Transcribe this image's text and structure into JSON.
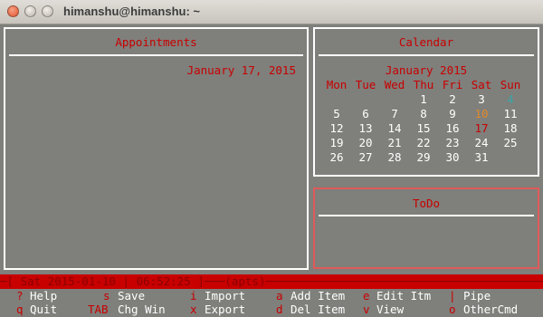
{
  "window": {
    "title": "himanshu@himanshu: ~"
  },
  "appointments": {
    "title": "Appointments",
    "date": "January 17, 2015"
  },
  "calendar": {
    "title": "Calendar",
    "month": "January 2015",
    "weekdays": [
      "Mon",
      "Tue",
      "Wed",
      "Thu",
      "Fri",
      "Sat",
      "Sun"
    ],
    "weeks": [
      [
        "",
        "",
        "",
        "1",
        "2",
        "3",
        "4"
      ],
      [
        "5",
        "6",
        "7",
        "8",
        "9",
        "10",
        "11"
      ],
      [
        "12",
        "13",
        "14",
        "15",
        "16",
        "17",
        "18"
      ],
      [
        "19",
        "20",
        "21",
        "22",
        "23",
        "24",
        "25"
      ],
      [
        "26",
        "27",
        "28",
        "29",
        "30",
        "31",
        ""
      ]
    ],
    "highlights": {
      "4": "#3aa6a6",
      "10": "#e08a2a",
      "17": "#c80000"
    }
  },
  "todo": {
    "title": "ToDo"
  },
  "status": {
    "text": "─[ Sat 2015-01-10 | 06:52:25 ]───(apts)──────────────────────────────────────────────────"
  },
  "help": {
    "row1": [
      {
        "key": "?",
        "label": "Help"
      },
      {
        "key": "s",
        "label": "Save"
      },
      {
        "key": "i",
        "label": "Import"
      },
      {
        "key": "a",
        "label": "Add Item"
      },
      {
        "key": "e",
        "label": "Edit Itm"
      },
      {
        "key": "|",
        "label": "Pipe"
      }
    ],
    "row2": [
      {
        "key": "q",
        "label": "Quit"
      },
      {
        "key": "TAB",
        "label": "Chg Win"
      },
      {
        "key": "x",
        "label": "Export"
      },
      {
        "key": "d",
        "label": "Del Item"
      },
      {
        "key": "v",
        "label": "View"
      },
      {
        "key": "o",
        "label": "OtherCmd"
      }
    ]
  },
  "colors": {
    "accent": "#c80000",
    "terminal_bg": "#7f7f7b"
  }
}
